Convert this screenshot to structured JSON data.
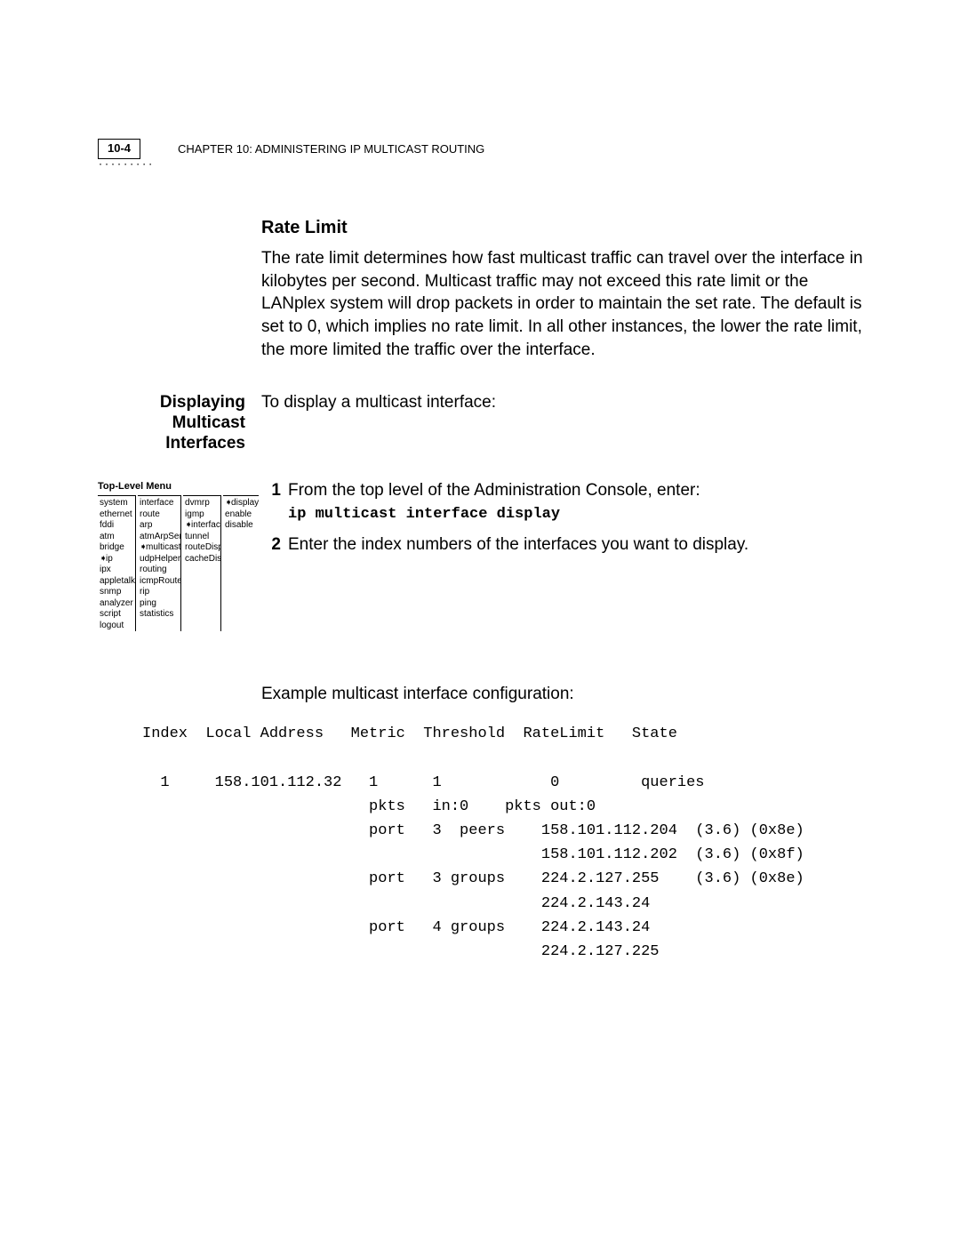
{
  "header": {
    "page_num": "10-4",
    "chapter_label": "CHAPTER 10: ADMINISTERING IP MULTICAST ROUTING"
  },
  "rate_limit": {
    "heading": "Rate Limit",
    "body": "The rate limit determines how fast multicast traffic can travel over the interface in kilobytes per second. Multicast traffic may not exceed this rate limit or the LANplex system will drop packets in order to maintain the set rate. The default is set to 0, which implies no rate limit. In all other instances, the lower the rate limit, the more limited the traffic over the interface."
  },
  "displaying": {
    "side_label": "Displaying Multicast Interfaces",
    "intro": "To display a multicast interface:"
  },
  "menu": {
    "title": "Top-Level Menu",
    "col1": [
      "system",
      "ethernet",
      "fddi",
      "atm",
      "bridge",
      "ip",
      "ipx",
      "appletalk",
      "snmp",
      "analyzer",
      "script",
      "logout"
    ],
    "col2": [
      "interface",
      "route",
      "arp",
      "atmArpServer",
      "multicast",
      "udpHelper",
      "routing",
      "icmpRouterDiscovery",
      "rip",
      "ping",
      "statistics"
    ],
    "col3": [
      "dvmrp",
      "igmp",
      "interface",
      "tunnel",
      "routeDisplay",
      "cacheDisplay"
    ],
    "col4": [
      "display",
      "enable",
      "disable"
    ],
    "sel1": "ip",
    "sel2": "multicast",
    "sel3": "interface",
    "sel4": "display"
  },
  "steps": {
    "s1_num": "1",
    "s1_text": "From the top level of the Administration Console, enter:",
    "s1_cmd": "ip multicast interface display",
    "s2_num": "2",
    "s2_text": "Enter the index numbers of the interfaces you want to display."
  },
  "example": {
    "label": "Example multicast interface configuration:",
    "output": "Index  Local Address   Metric  Threshold  RateLimit   State\n\n  1     158.101.112.32   1      1            0         queries\n                         pkts   in:0    pkts out:0\n                         port   3  peers    158.101.112.204  (3.6) (0x8e)\n                                            158.101.112.202  (3.6) (0x8f)\n                         port   3 groups    224.2.127.255    (3.6) (0x8e)\n                                            224.2.143.24\n                         port   4 groups    224.2.143.24\n                                            224.2.127.225"
  }
}
